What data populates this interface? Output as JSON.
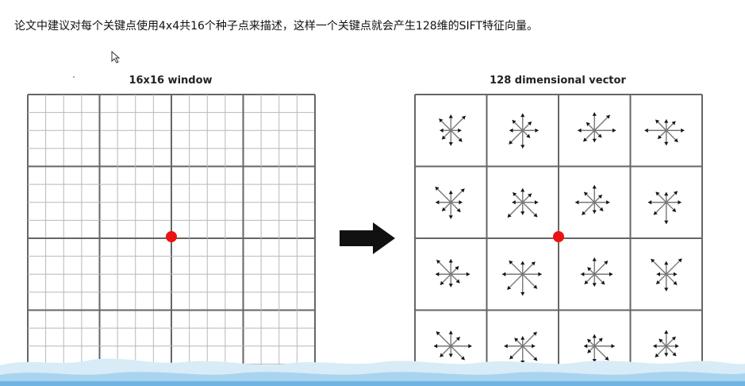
{
  "caption": "论文中建议对每个关键点使用4x4共16个种子点来描述，这样一个关键点就会产生128维的SIFT特征向量。",
  "left_panel": {
    "title": "16x16 window"
  },
  "right_panel": {
    "title": "128 dimensional vector"
  },
  "colors": {
    "keypoint": "#ee1111",
    "grid_major": "#666666",
    "grid_minor": "#b8b8b8",
    "arrow": "#111111",
    "water": "#7fc1ea"
  },
  "icons": [
    "cursor-icon",
    "right-arrow-icon"
  ]
}
